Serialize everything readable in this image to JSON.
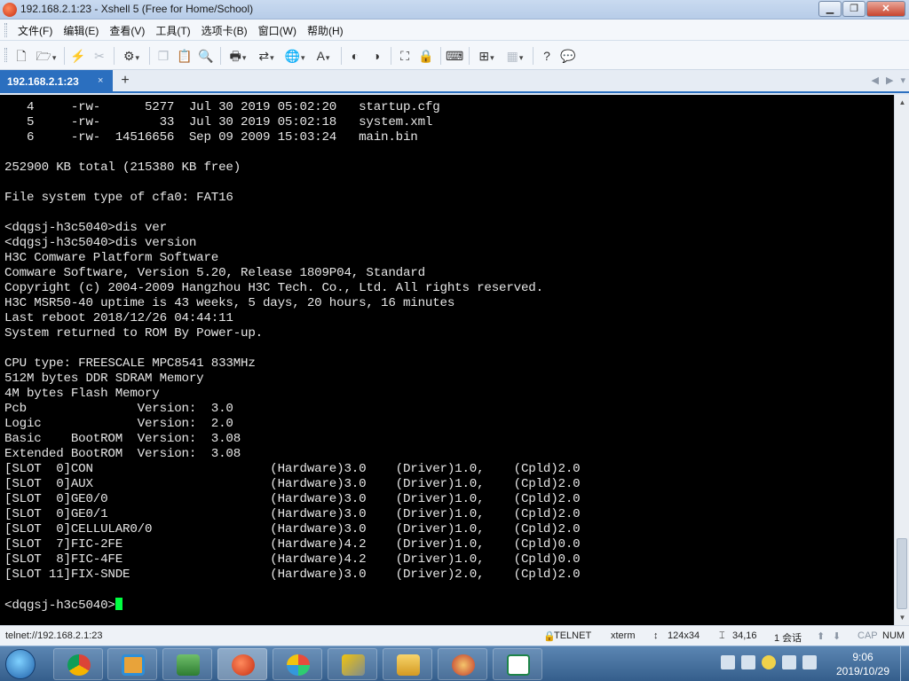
{
  "window": {
    "title": "192.168.2.1:23 - Xshell 5 (Free for Home/School)"
  },
  "title_buttons": {
    "minimize": "▁",
    "maximize": "❐",
    "close": "✕"
  },
  "menu": [
    "文件(F)",
    "编辑(E)",
    "查看(V)",
    "工具(T)",
    "选项卡(B)",
    "窗口(W)",
    "帮助(H)"
  ],
  "toolbar_icons": [
    "new-session-icon",
    "open-folder-icon",
    "reconnect-icon",
    "disconnect-icon",
    "properties-icon",
    "copy-icon",
    "paste-icon",
    "find-icon",
    "print-icon",
    "transfer-icon",
    "globe-icon",
    "font-icon",
    "xftp-icon",
    "xmanager-icon",
    "fullscreen-icon",
    "lock-icon",
    "keyboard-icon",
    "compose-icon",
    "layout-icon",
    "help-icon",
    "chat-icon"
  ],
  "tabs": [
    {
      "label": "192.168.2.1:23",
      "close": "×"
    }
  ],
  "new_tab": "+",
  "terminal_lines": [
    "   4     -rw-      5277  Jul 30 2019 05:02:20   startup.cfg",
    "   5     -rw-        33  Jul 30 2019 05:02:18   system.xml",
    "   6     -rw-  14516656  Sep 09 2009 15:03:24   main.bin",
    "",
    "252900 KB total (215380 KB free)",
    "",
    "File system type of cfa0: FAT16",
    "",
    "<dqgsj-h3c5040>dis ver",
    "<dqgsj-h3c5040>dis version",
    "H3C Comware Platform Software",
    "Comware Software, Version 5.20, Release 1809P04, Standard",
    "Copyright (c) 2004-2009 Hangzhou H3C Tech. Co., Ltd. All rights reserved.",
    "H3C MSR50-40 uptime is 43 weeks, 5 days, 20 hours, 16 minutes",
    "Last reboot 2018/12/26 04:44:11",
    "System returned to ROM By Power-up.",
    "",
    "CPU type: FREESCALE MPC8541 833MHz",
    "512M bytes DDR SDRAM Memory",
    "4M bytes Flash Memory",
    "Pcb               Version:  3.0",
    "Logic             Version:  2.0",
    "Basic    BootROM  Version:  3.08",
    "Extended BootROM  Version:  3.08",
    "[SLOT  0]CON                        (Hardware)3.0    (Driver)1.0,    (Cpld)2.0",
    "[SLOT  0]AUX                        (Hardware)3.0    (Driver)1.0,    (Cpld)2.0",
    "[SLOT  0]GE0/0                      (Hardware)3.0    (Driver)1.0,    (Cpld)2.0",
    "[SLOT  0]GE0/1                      (Hardware)3.0    (Driver)1.0,    (Cpld)2.0",
    "[SLOT  0]CELLULAR0/0                (Hardware)3.0    (Driver)1.0,    (Cpld)2.0",
    "[SLOT  7]FIC-2FE                    (Hardware)4.2    (Driver)1.0,    (Cpld)0.0",
    "[SLOT  8]FIC-4FE                    (Hardware)4.2    (Driver)1.0,    (Cpld)0.0",
    "[SLOT 11]FIX-SNDE                   (Hardware)3.0    (Driver)2.0,    (Cpld)2.0",
    ""
  ],
  "prompt": "<dqgsj-h3c5040>",
  "colors": {
    "terminal_bg": "#000000",
    "terminal_fg": "#e6e6e6",
    "cursor": "#00ff41",
    "tab_active": "#2b6fbf"
  },
  "status": {
    "connection": "telnet://192.168.2.1:23",
    "protocol": "TELNET",
    "terminal_type": "xterm",
    "size": "124x34",
    "cursor_pos": "34,16",
    "sessions": "1 会话",
    "caps": "CAP",
    "num": "NUM"
  },
  "clock": {
    "time": "9:06",
    "date": "2019/10/29"
  }
}
